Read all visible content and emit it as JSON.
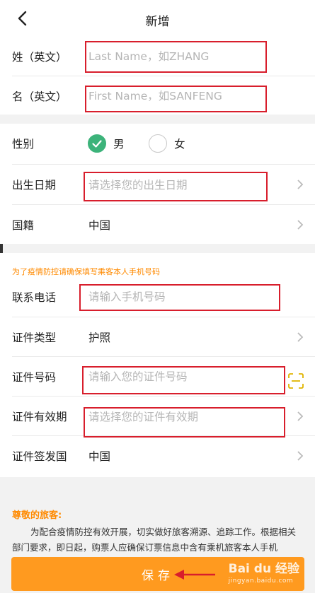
{
  "header": {
    "title": "新增"
  },
  "name_section": {
    "surname_label": "姓（英文）",
    "surname_placeholder": "Last Name，如ZHANG",
    "given_label": "名（英文）",
    "given_placeholder": "First Name，如SANFENG"
  },
  "info_section": {
    "gender_label": "性别",
    "gender_male": "男",
    "gender_female": "女",
    "gender_selected": "男",
    "birth_label": "出生日期",
    "birth_placeholder": "请选择您的出生日期",
    "nation_label": "国籍",
    "nation_value": "中国"
  },
  "notice": "为了疫情防控请确保填写乘客本人手机号码",
  "contact_section": {
    "phone_label": "联系电话",
    "phone_placeholder": "请输入手机号码",
    "idtype_label": "证件类型",
    "idtype_value": "护照",
    "idno_label": "证件号码",
    "idno_placeholder": "请输入您的证件号码",
    "expiry_label": "证件有效期",
    "expiry_placeholder": "请选择您的证件有效期",
    "issuer_label": "证件签发国",
    "issuer_value": "中国"
  },
  "tip": {
    "title": "尊敬的旅客:",
    "body": "为配合疫情防控有效开展，切实做好旅客溯源、追踪工作。根据相关部门要求，即日起，购票人应确保订票信息中含有乘机旅客本人手机"
  },
  "save_label": "保存",
  "watermark": {
    "brand": "Bai du 经验",
    "url": "jingyan.baidu.com"
  },
  "colors": {
    "accent": "#ff9a1f",
    "selected": "#3cb37a",
    "highlight": "#d81e2c",
    "notice": "#ff8a00"
  }
}
